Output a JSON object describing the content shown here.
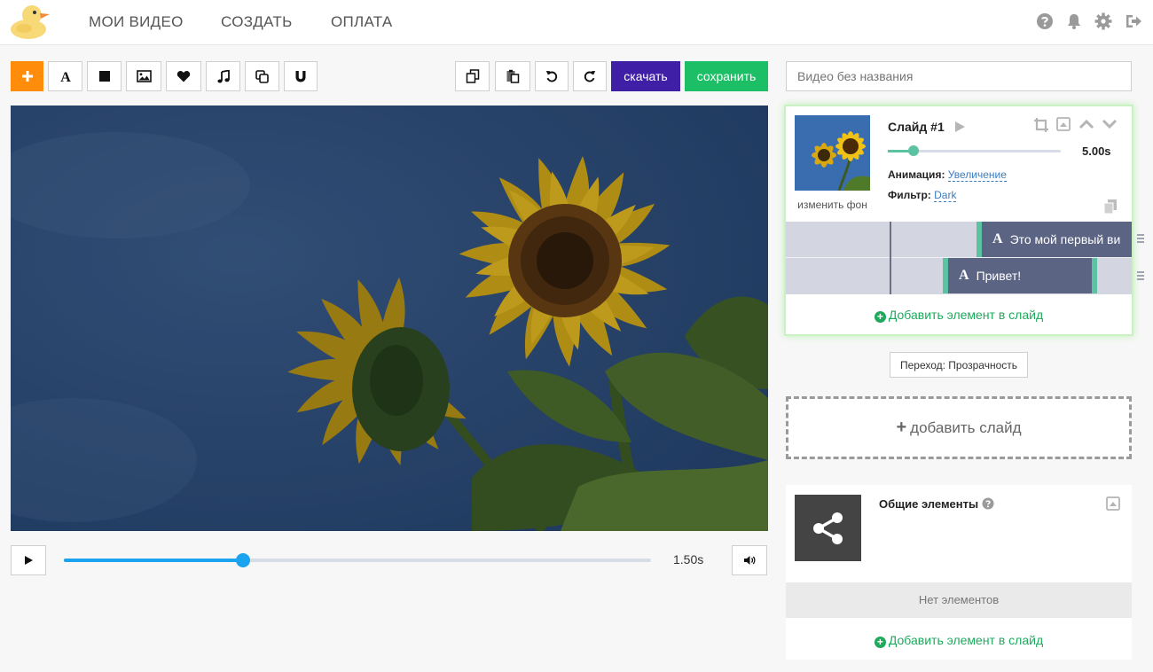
{
  "header": {
    "nav": [
      "МОИ ВИДЕО",
      "СОЗДАТЬ",
      "ОПЛАТА"
    ]
  },
  "toolbar": {
    "download_label": "скачать",
    "save_label": "сохранить"
  },
  "player": {
    "time": "1.50s",
    "progress": 0.305
  },
  "video_title": {
    "placeholder": "Видео без названия"
  },
  "slide": {
    "title": "Слайд #1",
    "change_bg": "изменить фон",
    "duration": "5.00s",
    "duration_fraction": 0.15,
    "animation_label": "Анимация:",
    "animation_value": "Увеличение",
    "filter_label": "Фильтр:",
    "filter_value": "Dark",
    "layers": [
      {
        "label": "Это мой первый ви"
      },
      {
        "label": "Привет!"
      }
    ],
    "add_element": "Добавить элемент в слайд"
  },
  "transition": "Переход: Прозрачность",
  "add_slide": "добавить слайд",
  "common": {
    "title": "Общие элементы",
    "empty": "Нет элементов",
    "add_element": "Добавить элемент в слайд"
  },
  "colors": {
    "accent_orange": "#ff8c0a",
    "download_purple": "#3f1fa6",
    "save_green": "#1dbf66",
    "timeline_blue": "#1aa3ef",
    "layer_bar": "#5c6484",
    "layer_edge": "#5cc3a2"
  },
  "icons": [
    "duck-logo",
    "help-icon",
    "bell-icon",
    "gear-icon",
    "logout-icon",
    "plus-icon",
    "text-icon",
    "square-icon",
    "image-icon",
    "heart-icon",
    "music-icon",
    "copy-icon",
    "magnet-icon",
    "paste-icon",
    "undo-icon",
    "redo-icon",
    "play-icon",
    "volume-icon",
    "crop-icon",
    "collapse-icon",
    "chevron-up-icon",
    "chevron-down-icon",
    "share-icon"
  ]
}
